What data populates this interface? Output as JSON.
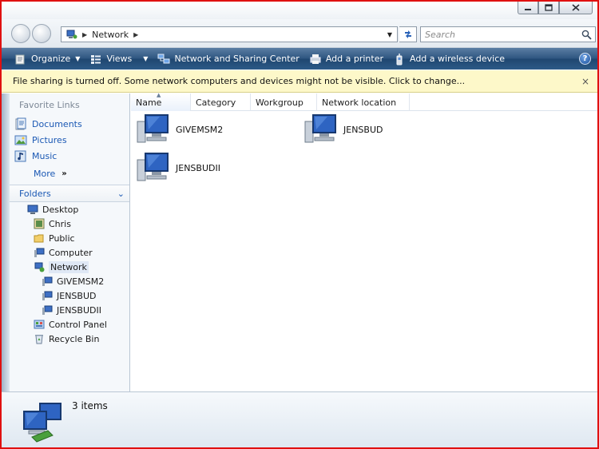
{
  "window": {
    "caption_buttons": [
      "minimize",
      "maximize",
      "close"
    ]
  },
  "address": {
    "location": "Network",
    "search_placeholder": "Search"
  },
  "toolbar": {
    "organize": "Organize",
    "views": "Views",
    "network_sharing": "Network and Sharing Center",
    "add_printer": "Add a printer",
    "add_wireless": "Add a wireless device",
    "help": "?"
  },
  "infobar": {
    "message": "File sharing is turned off. Some network computers and devices might not be visible. Click to change...",
    "close": "×"
  },
  "nav": {
    "favorite_links_title": "Favorite Links",
    "favorites": [
      {
        "label": "Documents",
        "icon": "documents-icon"
      },
      {
        "label": "Pictures",
        "icon": "pictures-icon"
      },
      {
        "label": "Music",
        "icon": "music-icon"
      }
    ],
    "more": "More",
    "more_chevron": "»",
    "folders_title": "Folders",
    "folders_chevron": "⌄",
    "tree": [
      {
        "label": "Desktop",
        "icon": "desktop-icon"
      },
      {
        "label": "Chris",
        "icon": "user-folder-icon"
      },
      {
        "label": "Public",
        "icon": "folder-icon"
      },
      {
        "label": "Computer",
        "icon": "computer-icon"
      },
      {
        "label": "Network",
        "icon": "network-icon"
      },
      {
        "label": "GIVEMSM2",
        "icon": "computer-icon"
      },
      {
        "label": "JENSBUD",
        "icon": "computer-icon"
      },
      {
        "label": "JENSBUDII",
        "icon": "computer-icon"
      },
      {
        "label": "Control Panel",
        "icon": "control-panel-icon"
      },
      {
        "label": "Recycle Bin",
        "icon": "recycle-bin-icon"
      }
    ]
  },
  "columns": [
    "Name",
    "Category",
    "Workgroup",
    "Network location"
  ],
  "items": [
    {
      "label": "GIVEMSM2",
      "icon": "computer-icon"
    },
    {
      "label": "JENSBUD",
      "icon": "computer-icon"
    },
    {
      "label": "JENSBUDII",
      "icon": "computer-icon"
    }
  ],
  "details": {
    "count": "3 items"
  },
  "colors": {
    "cmdbar": "#2d5580",
    "infobar": "#fdf8c9",
    "link": "#1a58b4",
    "border": "#e01010"
  }
}
